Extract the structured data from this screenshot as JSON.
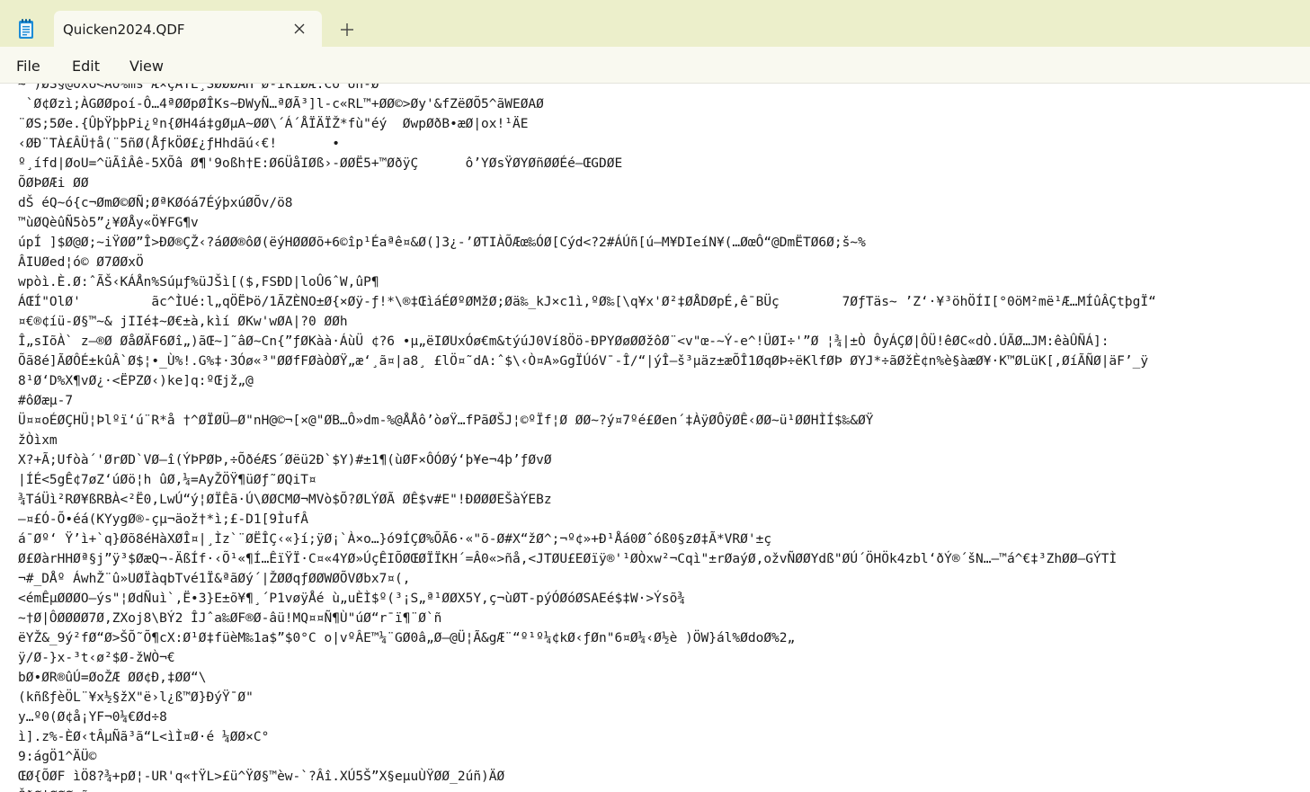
{
  "app": {
    "icon": "notepad-icon",
    "tab_title": "Quicken2024.QDF",
    "close_icon": "close-icon",
    "new_tab_icon": "plus-icon"
  },
  "menu": {
    "file": "File",
    "edit": "Edit",
    "view": "View"
  },
  "editor": {
    "lines": [
      "~ )ØS§@óxÜ<Aó%ms Æ×ÇÄTE¸SØØØAH ø-ïkïØÆ.Co¨Un-Ø",
      " `Ø¢Øzì;ÀGØØpoí-Ô…4ªØØpØÎKs~ÐWyÑ…ªØÃ³]l-c«RL™+ØØ©>Øy'&fZëØÕ5^ãWEØAØ",
      "¨ØS;5Øe.{ÛþŸþþPi¿ºn{ØH4á‡gØµA~ØØ\\´Á´ÅÏÄÏŽ*fù\"éý  ØwpØðB•æØ|ox!¹ÄE",
      "‹ØÐ¨TÀ£ÂÜ†å(¨5ñØ(ÅƒkÖØ£¿ƒHhdãú‹€!       •",
      "º¸ífd|ØoU=^üÃîÂê-5XÕâ Ø¶'9oßh†E:Ø6ÜåIØß›-ØØË5+™ØðÿÇ      ô’YØsŸØYØñØØÉé–ŒGDØE",
      "ÕØÞØÆi ØØ",
      "dŠ éQ~ó{c¬ØmØ©ØÑ;ØªKØóá7ÉýþxúØÕv/ö8",
      "™ùØQèûÑ5ò5”¿¥ØÅy«Ö¥FG¶v",
      "úpÍ ]$Ø@Ø;~iŸØØ”Î>ÐØ®ÇŽ‹?áØØ®ôØ(ëýHØØØõ+6©îp¹Éaªê¤&Ø(]3¿-’ØTIÀÕÆœ‰ÓØ[Cýd<?2#ÁÚñ[ú—M¥DIeíN¥(…ØœÔ“@DmËTØ6Ø;š~%",
      "ÂIUØed¦ó© Ø7ØØxÖ",
      "wpòì.È.Ø:ˆÃŠ‹KÁÅn%Súµƒ%üJŠì[($,FSÐD|loÛ6ˆW,ûP¶",
      "ÁŒÍ\"OlØ'         ãc^ÌUé:l„qÖËÞö/1ÃZÈNO±Ø{×Øÿ-ƒ!*\\®‡ŒìáÉØºØMžØ;Øä‰_kJ×c1ì,ºØ‰[\\q¥x'Ø²‡ØÅDØpÉ,êˉBÜç        7Øƒ­Täs~ ’Z‘·¥³öhÖÍI[°0öM²më¹Æ…MÍûÂÇtþgÏ“",
      "¤€®¢íü-Ø§™~& jIIé‡~Ø€±à,kìí ØKw'wØA|?0 ØØh",
      "Î„sIõÀ` z–®Ø ØåØÄF6Øî„)ãŒ~]˜âØ~Cn{”ƒØKàà·ÁùÜ ¢?6 •µ„ëIØUxÓø€m&týúJ0Ví8Öö-ÐPYØøØØžôØ¨<v\"œ-~Ý-e^!ÜØI÷'”Ø ¦¾|±Ò ÔyÁÇØ|ÔÜ!êØC«dÒ.ÚÃØ…JM:êàÛÑÁ]:",
      "Õã8é]ÃØÔÉ±kûÂ`Ø$¦•_Ù%!.G%‡·3Óø«³\"ØØfFØàÒØŸ„æ‘¸ã¤|a8¸ £lÖ¤˜dA:ˆ$\\‹Ò¤A»GgÏÚóV¯-Î/“|ýÎ–š³µäz±æÕÎ1ØqØÞ÷ëKlfØÞ ØYJ*÷ãØžÈ¢n%è§àæØ¥·K™ØLüK[,ØíÃÑØ|äF’_ÿ",
      "8¹Ø‘D%X¶vØ¿·<ËPZØ‹)ke]q:ºŒjž„@",
      "#ôØæµ-7",
      "Ü¤¤oÉØÇHÜ¦Þlºï‘ú¨R*å †^ØÏØÜ–Ø\"nH@©¬[×@\"ØB…Ô»dm-%@ÅÅô’òøŸ…fPãØŠJ¦©ºÏf¦Ø ØØ~?ý¤7ºé£Øen´‡ÀÿØÔÿØÊ‹ØØ~ü¹ØØHÌÍ$‰&ØŸ",
      "žÒìxm",
      "X?+Ã;Ufòà´'ØrØD`VØ–î(ÝÞPØÞ,÷ÕðéÆS´Øëü2Ð`$Y)#±1¶(ùØF×ÔÓØý‘þ¥e¬4þ’ƒØvØ",
      "|ÍÉ<5gÊ¢7øZ‘úØö¦h ûØ,¼=AyŽÖŸ¶üØƒ˜ØQiT¤",
      "¾TáÜì²RØ¥ßRBÀ<²Ë0,LwÚ“ý¦ØÏÊã·Ú\\ØØCMØ¬MVò$Õ?ØLÝØÃ ØÊ$v#E\"!ÐØØØEŠàÝEBz",
      "—¤£Ó-Õ•éá(KYygØ®-çµ¬äož†*ì;£-D1[9ÌufÂ",
      "áˉØº‘ Ÿ’ì+`q}Øõ8éHàXØÎ¤|¸Ìz`¨ØËÎÇ‹«}í;ÿØ¡`À×o…}ó9ÍÇØ%ÕÃ6·«\"õ-Ø#X“žØ^;¬º¢»+Ð¹Åá0Øˆóß0§zØ‡Ã*VRØ'±ç",
      "Ø£ØàrHHØª§j”ÿ³$ØæQ¬-ÄßÍf·‹Õ¹«¶Í…ÊïŸÏ·C¤«4YØ»ÚçÊIÕØŒØÏÏKH´=Â0«>ñå,<JTØU£EØïÿ®'¹ØÒxw²¬Cqì\"±rØaýØ,ožvÑØØYdß\"ØÚ´ÖHÖk4zbl‘ðÝ®´šN…—™á^€‡³ZhØØ–GÝTÌ",
      "¬#_DÅº ÁwhŽ¨û»UØÏàqbTvé1Ï&ªãØý´|ŽØØqƒØØWØÕVØbx7¤(,",
      "<émÊµØØØO–ýs\"¦ØdÑuì`,Ë•3}E±õ¥¶¸´P1vøÿÅé ù„uÈÌ$º(³¡S„ª¹ØØX5Y,ç¬ùØT-pýÓØóØSAEé$‡W·>Ýsõ¾",
      "~†Ø|ÔØØØØ7Ø,ZXoj8\\BÝ2 ÎJˆa‰ØF®Ø-âü!MQ¤¤Ñ¶Ù\"úØ“r¯ï¶¨Ø`ñ",
      "ëYŽ&_9ý²fØ“Ø>ŠÕ˜Õ¶cX:Ø¹Ø‡füèM‰1a$”$0°C o|vºÂE™¼¨GØ0â„Ø—@Ü¦Ã&gÆ¨“º¹º¼¢kØ‹ƒØn\"6¤Ø¼‹Ø½è )ÖW}ál%ØdoØ%2„",
      "ÿ/Ø-}x-³t‹ø²$Ø-žWÒ¬€",
      "bØ•ØR®ûÚ=ØoŽÆ ØØ¢Ð,‡ØØ“\\",
      "(kñßƒèÖL¨¥x½§žX\"ë›l¿ß™Ø}ÐýŸ¯Ø\"",
      "y…º0(Ø¢å¡YF¬0¼€Ød÷8",
      "ì].z%-ÈØ‹tÂµÑã³ã“L<ìÌ¤Ø·é ¼ØØ×C°",
      "9:ágÖ1^ÄÜ©",
      "ŒØ{ÕØF ìÖ8?¾+pØ¦-UR'q«†ŸL>£ü^ŸØ§™èw-`?Âî.XÚ5Š”X§eµuÙŸØØ_2úñ)ÄØ",
      "ŠðØ|ØØØ<õ"
    ]
  }
}
